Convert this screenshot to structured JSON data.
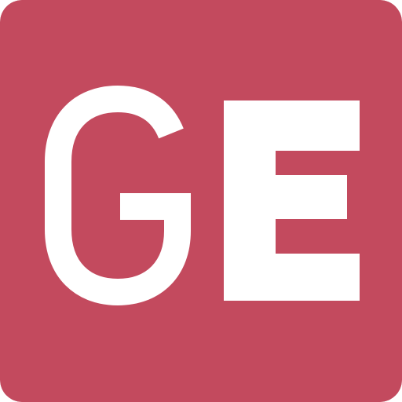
{
  "logo": {
    "text": "GE",
    "background_color": "#C34A5E",
    "letter_color": "#FFFFFF"
  }
}
